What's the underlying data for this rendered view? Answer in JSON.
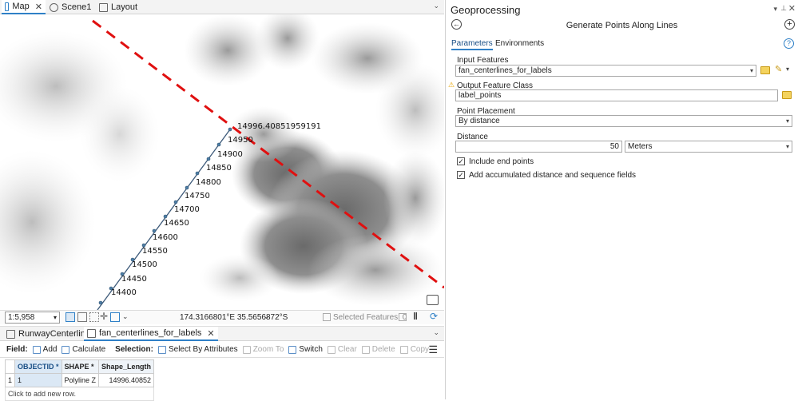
{
  "tabs": {
    "map": "Map",
    "scene": "Scene1",
    "layout": "Layout"
  },
  "map": {
    "annotation_top": "14996.40851959191",
    "labels": [
      "14950",
      "14900",
      "14850",
      "14800",
      "14750",
      "14700",
      "14650",
      "14600",
      "14550",
      "14500",
      "14450",
      "14400"
    ]
  },
  "map_status": {
    "scale": "1:5,958",
    "coordinates": "174.3166801°E 35.5656872°S",
    "selected_features": "Selected Features: 0"
  },
  "attribute_tabs": {
    "tab1": "RunwayCenterline",
    "tab2": "fan_centerlines_for_labels"
  },
  "attribute_toolbar": {
    "field_label": "Field:",
    "add": "Add",
    "calculate": "Calculate",
    "selection_label": "Selection:",
    "select_by_attributes": "Select By Attributes",
    "zoom_to": "Zoom To",
    "switch": "Switch",
    "clear": "Clear",
    "delete": "Delete",
    "copy": "Copy"
  },
  "table": {
    "headers": [
      "OBJECTID *",
      "SHAPE *",
      "Shape_Length"
    ],
    "row": {
      "index": "1",
      "objectid": "1",
      "shape": "Polyline Z",
      "length": "14996.40852"
    },
    "add_row": "Click to add new row."
  },
  "geoprocessing": {
    "pane_title": "Geoprocessing",
    "tool_title": "Generate Points Along Lines",
    "tab_parameters": "Parameters",
    "tab_environments": "Environments",
    "input_features_label": "Input Features",
    "input_features_value": "fan_centerlines_for_labels",
    "output_label": "Output Feature Class",
    "output_value": "label_points",
    "placement_label": "Point Placement",
    "placement_value": "By distance",
    "distance_label": "Distance",
    "distance_value": "50",
    "distance_unit": "Meters",
    "include_end_points": "Include end points",
    "add_accumulated": "Add accumulated distance and sequence fields"
  },
  "colors": {
    "accent": "#2f80c7",
    "dashed_line": "#e01010",
    "warning": "#e8a400"
  }
}
